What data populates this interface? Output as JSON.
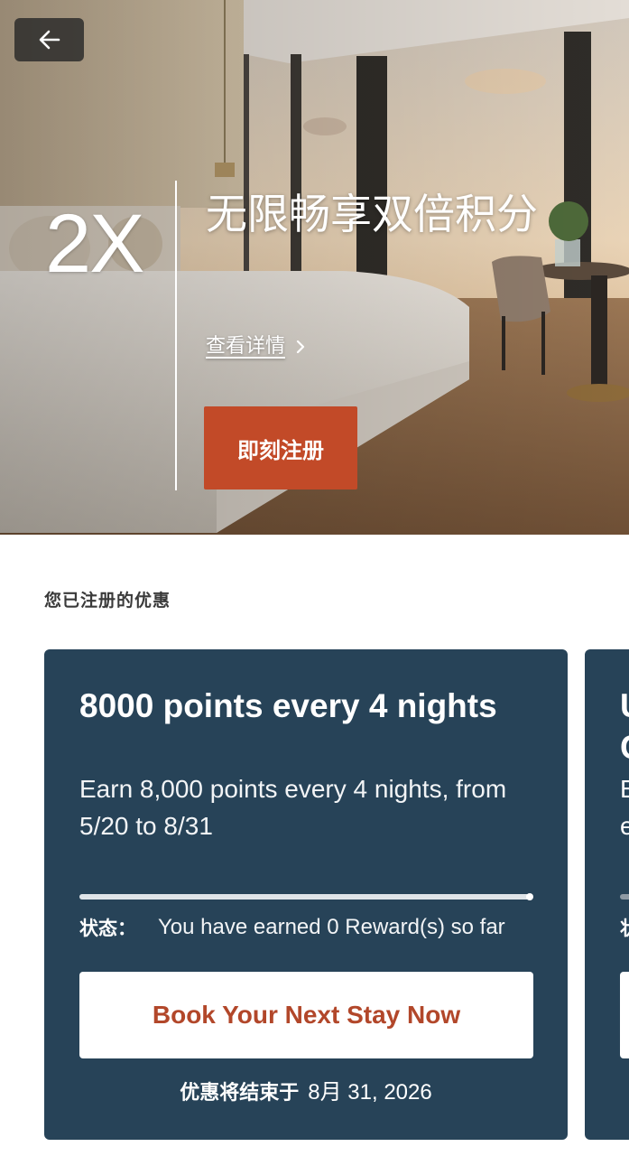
{
  "hero": {
    "multiplier": "2X",
    "title": "无限畅享双倍积分",
    "details_link": "查看详情",
    "register_button": "即刻注册"
  },
  "section": {
    "title": "您已注册的优惠"
  },
  "offers": [
    {
      "title": "8000 points every 4 nights",
      "description": "Earn 8,000 points every 4 nights, from 5/20 to 8/31",
      "progress": 1.0,
      "status_label": "状态：",
      "status_value": "You have earned 0 Reward(s) so far",
      "book_button": "Book Your Next Stay Now",
      "end_label": "优惠将结束于",
      "end_date": "8月 31, 2026"
    }
  ],
  "next_offer_peek": {
    "title_fragment_1": "U",
    "title_fragment_2": "C",
    "desc_fragment_1": "E",
    "desc_fragment_2": "e",
    "status_fragment": "状"
  },
  "colors": {
    "card_bg": "#274358",
    "brand_accent": "#c24a28",
    "button_text": "#b2472a"
  },
  "icons": {
    "back": "arrow-left-icon",
    "details_chevron": "chevron-right-icon"
  }
}
